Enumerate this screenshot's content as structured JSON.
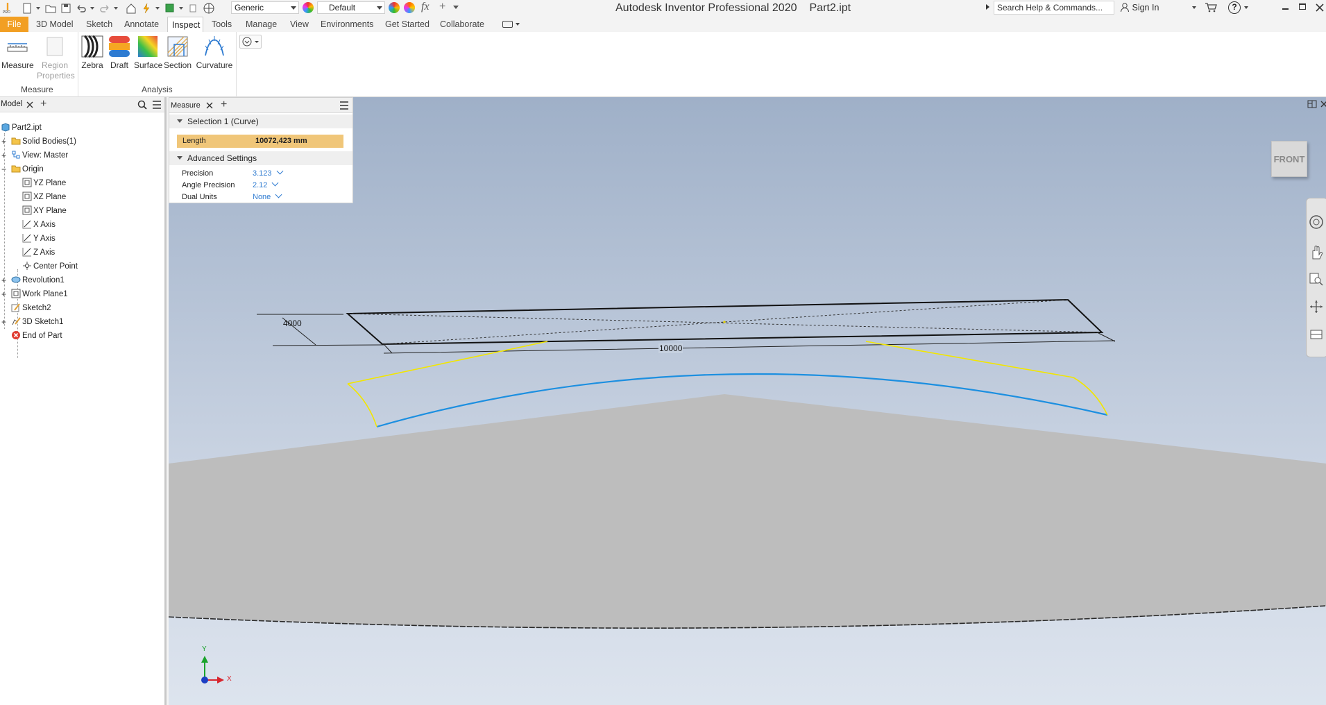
{
  "app": {
    "title": "Autodesk Inventor Professional 2020",
    "document": "Part2.ipt",
    "logo_sub": "PRO"
  },
  "quick_access": {
    "material_combo": "Generic",
    "appearance_combo": "Default",
    "fx_label": "fx"
  },
  "help": {
    "search_placeholder": "Search Help & Commands...",
    "sign_in": "Sign In",
    "help_glyph": "?"
  },
  "ribbon_tabs": [
    "File",
    "3D Model",
    "Sketch",
    "Annotate",
    "Inspect",
    "Tools",
    "Manage",
    "View",
    "Environments",
    "Get Started",
    "Collaborate"
  ],
  "active_tab": "Inspect",
  "ribbon": {
    "measure_label": "Measure",
    "region_label": "Region",
    "properties_label": "Properties",
    "zebra_label": "Zebra",
    "draft_label": "Draft",
    "surface_label": "Surface",
    "section_label": "Section",
    "curvature_label": "Curvature",
    "group_measure": "Measure",
    "group_analysis": "Analysis"
  },
  "browser": {
    "tab_label": "Model",
    "items": [
      {
        "label": "Part2.ipt",
        "icon": "part-icon"
      },
      {
        "label": "Solid Bodies(1)",
        "icon": "folder-icon"
      },
      {
        "label": "View: Master",
        "icon": "view-icon"
      },
      {
        "label": "Origin",
        "icon": "folder-open-icon"
      },
      {
        "label": "YZ Plane",
        "icon": "plane-icon"
      },
      {
        "label": "XZ Plane",
        "icon": "plane-icon"
      },
      {
        "label": "XY Plane",
        "icon": "plane-icon"
      },
      {
        "label": "X Axis",
        "icon": "axis-icon"
      },
      {
        "label": "Y Axis",
        "icon": "axis-icon"
      },
      {
        "label": "Z Axis",
        "icon": "axis-icon"
      },
      {
        "label": "Center Point",
        "icon": "point-icon"
      },
      {
        "label": "Revolution1",
        "icon": "revolution-icon"
      },
      {
        "label": "Work Plane1",
        "icon": "plane-icon"
      },
      {
        "label": "Sketch2",
        "icon": "sketch-icon"
      },
      {
        "label": "3D Sketch1",
        "icon": "sketch3d-icon"
      },
      {
        "label": "End of Part",
        "icon": "end-of-part-icon"
      }
    ]
  },
  "measure_panel": {
    "tab_label": "Measure",
    "selection_header": "Selection 1 (Curve)",
    "length_label": "Length",
    "length_value": "10072,423 mm",
    "advanced_header": "Advanced Settings",
    "precision_label": "Precision",
    "precision_value": "3.123",
    "angle_precision_label": "Angle Precision",
    "angle_precision_value": "2.12",
    "dual_units_label": "Dual Units",
    "dual_units_value": "None"
  },
  "viewport": {
    "dim_depth": "4000",
    "dim_width": "10000",
    "viewcube_label": "FRONT",
    "triad_x": "X",
    "triad_y": "Y"
  },
  "colors": {
    "file_tab": "#f29f23",
    "length_highlight": "#f0c679",
    "selection_curve": "#1c8fe0",
    "edge_highlight": "#f2e600",
    "viewport_top": "#9fb0c8",
    "viewport_bottom": "#dde4ee"
  }
}
